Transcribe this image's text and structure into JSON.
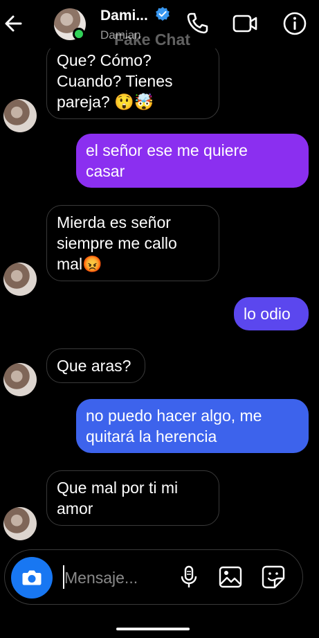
{
  "header": {
    "name": "Dami...",
    "subtitle": "Damian",
    "watermark": "Fake Chat",
    "back_icon": "arrow-left-icon",
    "verified_icon": "verified-badge-icon",
    "call_icon": "phone-icon",
    "video_icon": "video-camera-icon",
    "info_icon": "info-icon"
  },
  "messages": [
    {
      "direction": "in",
      "text": "Que? Cómo?\nCuando? Tienes\npareja? 😲🤯"
    },
    {
      "direction": "out",
      "text": "el señor ese me quiere\ncasar",
      "color": "#8b2ff0"
    },
    {
      "direction": "in",
      "text": "Mierda es señor\nsiempre me callo\nmal😡"
    },
    {
      "direction": "out",
      "text": "lo odio",
      "color": "#5b47ee"
    },
    {
      "direction": "in",
      "text": "Que aras?"
    },
    {
      "direction": "out",
      "text": "no puedo hacer algo, me\nquitará la herencia",
      "color": "#3d63ec"
    },
    {
      "direction": "in",
      "text": "Que mal por ti mi\namor"
    }
  ],
  "composer": {
    "placeholder": "Mensaje...",
    "camera_icon": "camera-icon",
    "mic_icon": "microphone-icon",
    "image_icon": "image-icon",
    "sticker_icon": "sticker-icon"
  },
  "colors": {
    "background": "#000000",
    "online": "#31d158",
    "verified": "#3897f0",
    "camera_button": "#1877f2",
    "incoming_border": "#3a3a3a"
  }
}
